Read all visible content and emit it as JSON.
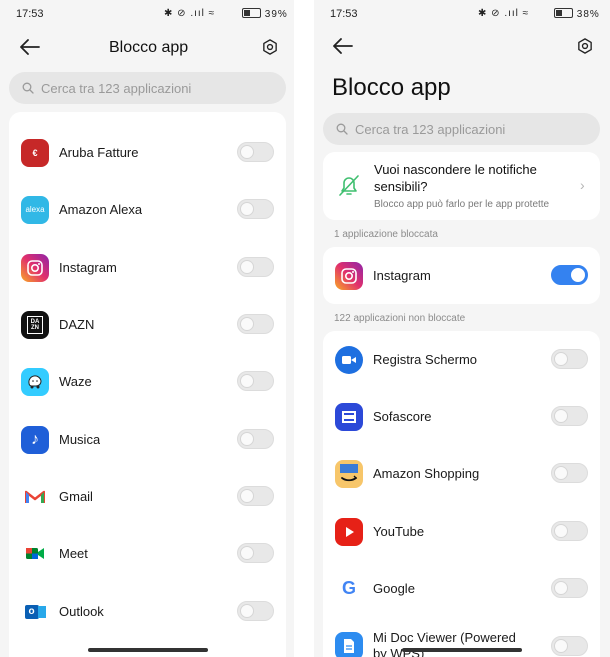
{
  "left": {
    "status": {
      "time": "17:53",
      "icons": "✱ ⊘ .ııl ≈",
      "battery": "39",
      "battery_level": 0.39
    },
    "header": {
      "title": "Blocco app"
    },
    "search": {
      "placeholder": "Cerca tra 123 applicazioni"
    },
    "apps": [
      {
        "name": "Aruba Fatture",
        "icon": "aruba-fatture-icon",
        "enabled": false
      },
      {
        "name": "Amazon Alexa",
        "icon": "amazon-alexa-icon",
        "enabled": false
      },
      {
        "name": "Instagram",
        "icon": "instagram-icon",
        "enabled": false
      },
      {
        "name": "DAZN",
        "icon": "dazn-icon",
        "enabled": false
      },
      {
        "name": "Waze",
        "icon": "waze-icon",
        "enabled": false
      },
      {
        "name": "Musica",
        "icon": "music-icon",
        "enabled": false
      },
      {
        "name": "Gmail",
        "icon": "gmail-icon",
        "enabled": false
      },
      {
        "name": "Meet",
        "icon": "meet-icon",
        "enabled": false
      },
      {
        "name": "Outlook",
        "icon": "outlook-icon",
        "enabled": false
      }
    ]
  },
  "right": {
    "status": {
      "time": "17:53",
      "icons": "✱ ⊘ .ııl ≈",
      "battery": "38",
      "battery_level": 0.38
    },
    "header": {
      "title": "Blocco app"
    },
    "search": {
      "placeholder": "Cerca tra 123 applicazioni"
    },
    "notification": {
      "title": "Vuoi nascondere le notifiche sensibili?",
      "subtitle": "Blocco app può farlo per le app protette"
    },
    "locked_label": "1 applicazione bloccata",
    "locked_apps": [
      {
        "name": "Instagram",
        "icon": "instagram-icon",
        "enabled": true
      }
    ],
    "unlocked_label": "122 applicazioni non bloccate",
    "unlocked_apps": [
      {
        "name": "Registra Schermo",
        "icon": "screen-recorder-icon",
        "enabled": false
      },
      {
        "name": "Sofascore",
        "icon": "sofascore-icon",
        "enabled": false
      },
      {
        "name": "Amazon Shopping",
        "icon": "amazon-shopping-icon",
        "enabled": false
      },
      {
        "name": "YouTube",
        "icon": "youtube-icon",
        "enabled": false
      },
      {
        "name": "Google",
        "icon": "google-icon",
        "enabled": false
      },
      {
        "name": "Mi Doc Viewer (Powered by WPS)",
        "icon": "mi-doc-viewer-icon",
        "enabled": false
      }
    ]
  },
  "colors": {
    "toggle_on": "#3482f0",
    "instagram": "#e1306c",
    "youtube": "#e62117"
  }
}
